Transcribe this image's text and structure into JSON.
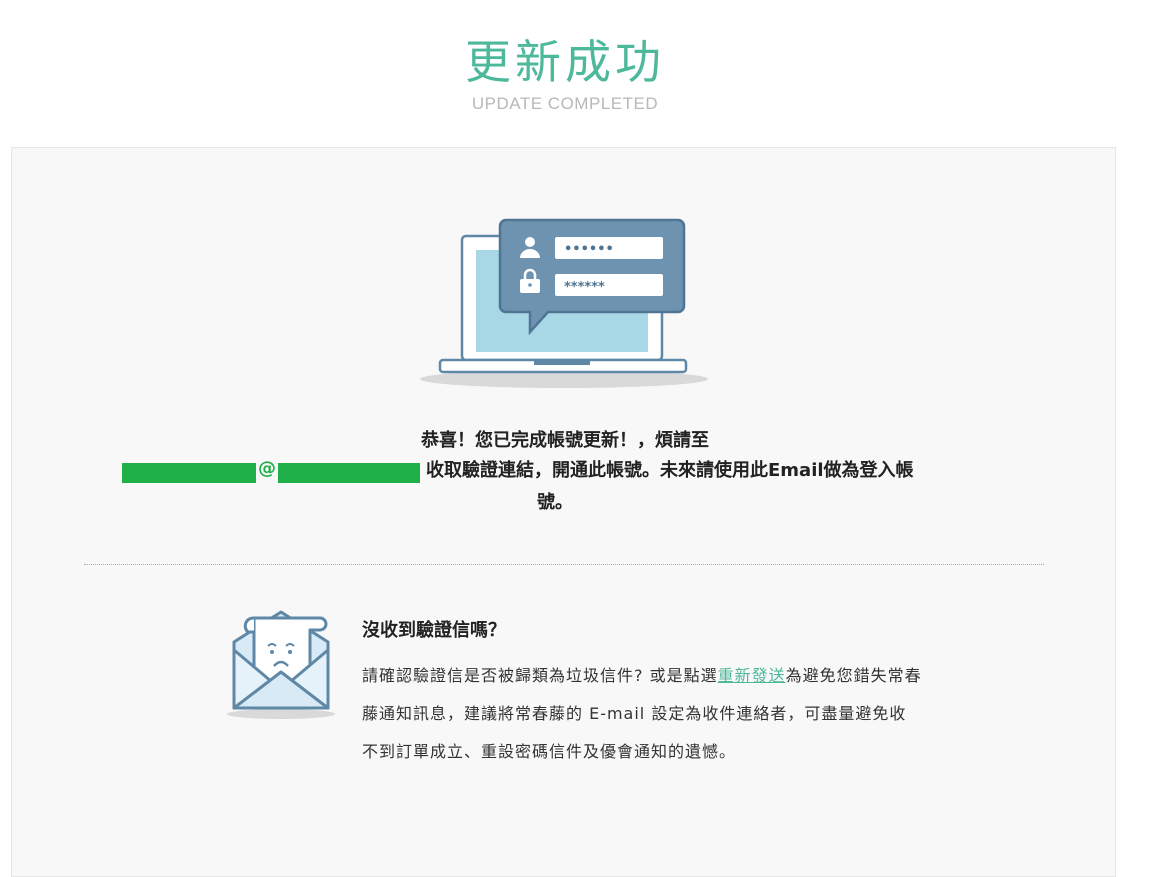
{
  "header": {
    "title": "更新成功",
    "subtitle": "UPDATE COMPLETED"
  },
  "login_card": {
    "username_mask": "••••••",
    "password_mask": "******"
  },
  "message": {
    "line1": "恭喜！您已完成帳號更新！，煩請至",
    "at_symbol": "@",
    "line2_tail": "收取驗證連結，開通此帳號。未來請使用此Email做為登入帳",
    "line3": "號。"
  },
  "help": {
    "title": "沒收到驗證信嗎？",
    "body_before_link": "請確認驗證信是否被歸類為垃圾信件? 或是點選",
    "link_label": "重新發送",
    "body_after_link": "為避免您錯失常春藤通知訊息，建議將常春藤的 E-mail 設定為收件連絡者，可盡量避免收不到訂單成立、重設密碼信件及優會通知的遺憾。"
  },
  "colors": {
    "accent": "#4db89a",
    "redaction": "#1fb04a",
    "panel_bg": "#f8f8f8",
    "card_blue": "#6d93b0",
    "screen_blue": "#a8d8e6"
  },
  "icons": {
    "hero": "laptop-login-icon",
    "user": "user-icon",
    "lock": "lock-icon",
    "envelope": "sad-envelope-icon"
  }
}
